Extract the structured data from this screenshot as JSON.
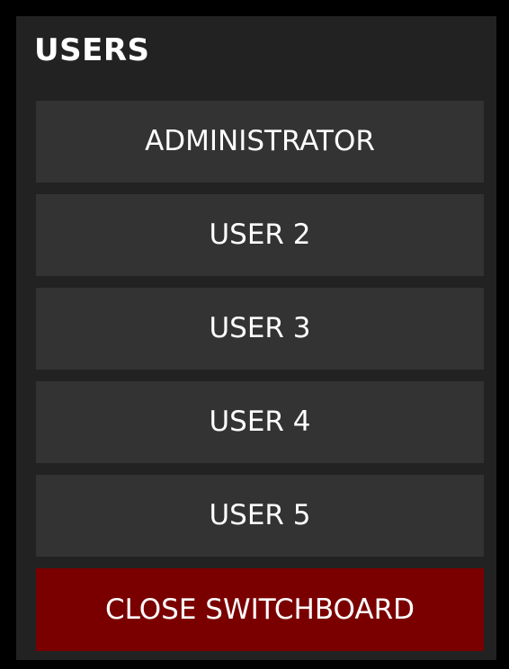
{
  "panel": {
    "title": "USERS"
  },
  "users": [
    {
      "label": "ADMINISTRATOR"
    },
    {
      "label": "USER 2"
    },
    {
      "label": "USER 3"
    },
    {
      "label": "USER 4"
    },
    {
      "label": "USER 5"
    }
  ],
  "close_button": {
    "label": "CLOSE SWITCHBOARD"
  },
  "colors": {
    "frame": "#000000",
    "panel_bg": "#222222",
    "button_bg": "#333333",
    "close_bg": "#7a0000",
    "text": "#ffffff"
  }
}
